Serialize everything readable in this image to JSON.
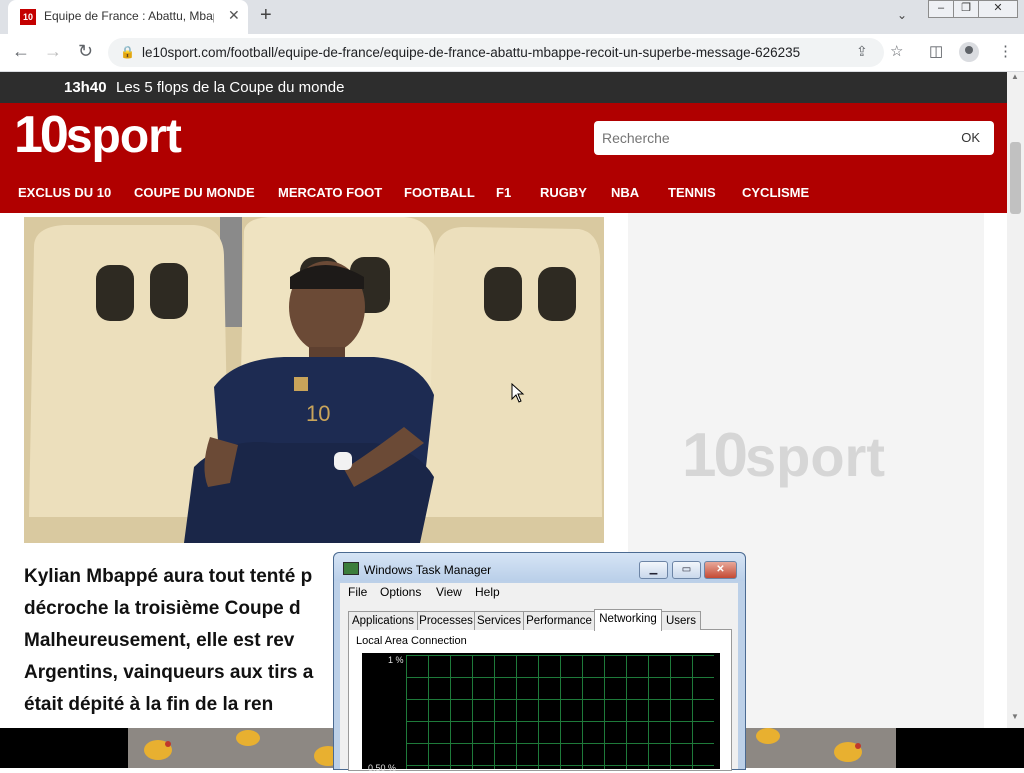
{
  "browser": {
    "tab_title": "Equipe de France : Abattu, Mbappé",
    "favicon_text": "10",
    "url": "le10sport.com/football/equipe-de-france/equipe-de-france-abattu-mbappe-recoit-un-superbe-message-626235"
  },
  "site": {
    "news_time": "13h40",
    "news_text": "Les 5 flops de la Coupe du monde",
    "logo_ten": "10",
    "logo_sport": "sport",
    "search_placeholder": "Recherche",
    "search_button": "OK",
    "menu": [
      "EXCLUS DU 10",
      "COUPE DU MONDE",
      "MERCATO FOOT",
      "FOOTBALL",
      "F1",
      "RUGBY",
      "NBA",
      "TENNIS",
      "CYCLISME"
    ],
    "ad_logo_ten": "10",
    "ad_logo_sport": "sport",
    "article_lines": [
      "Kylian Mbappé aura tout tenté p",
      "décroche la troisième Coupe d",
      "Malheureusement, elle est rev",
      "Argentins, vainqueurs aux tirs a",
      "était dépité à la fin de la ren"
    ]
  },
  "task_manager": {
    "title": "Windows Task Manager",
    "menu": [
      "File",
      "Options",
      "View",
      "Help"
    ],
    "tabs": [
      "Applications",
      "Processes",
      "Services",
      "Performance",
      "Networking",
      "Users"
    ],
    "active_tab": "Networking",
    "group_label": "Local Area Connection",
    "graph_labels": [
      "1 %",
      "0.50 %"
    ]
  }
}
